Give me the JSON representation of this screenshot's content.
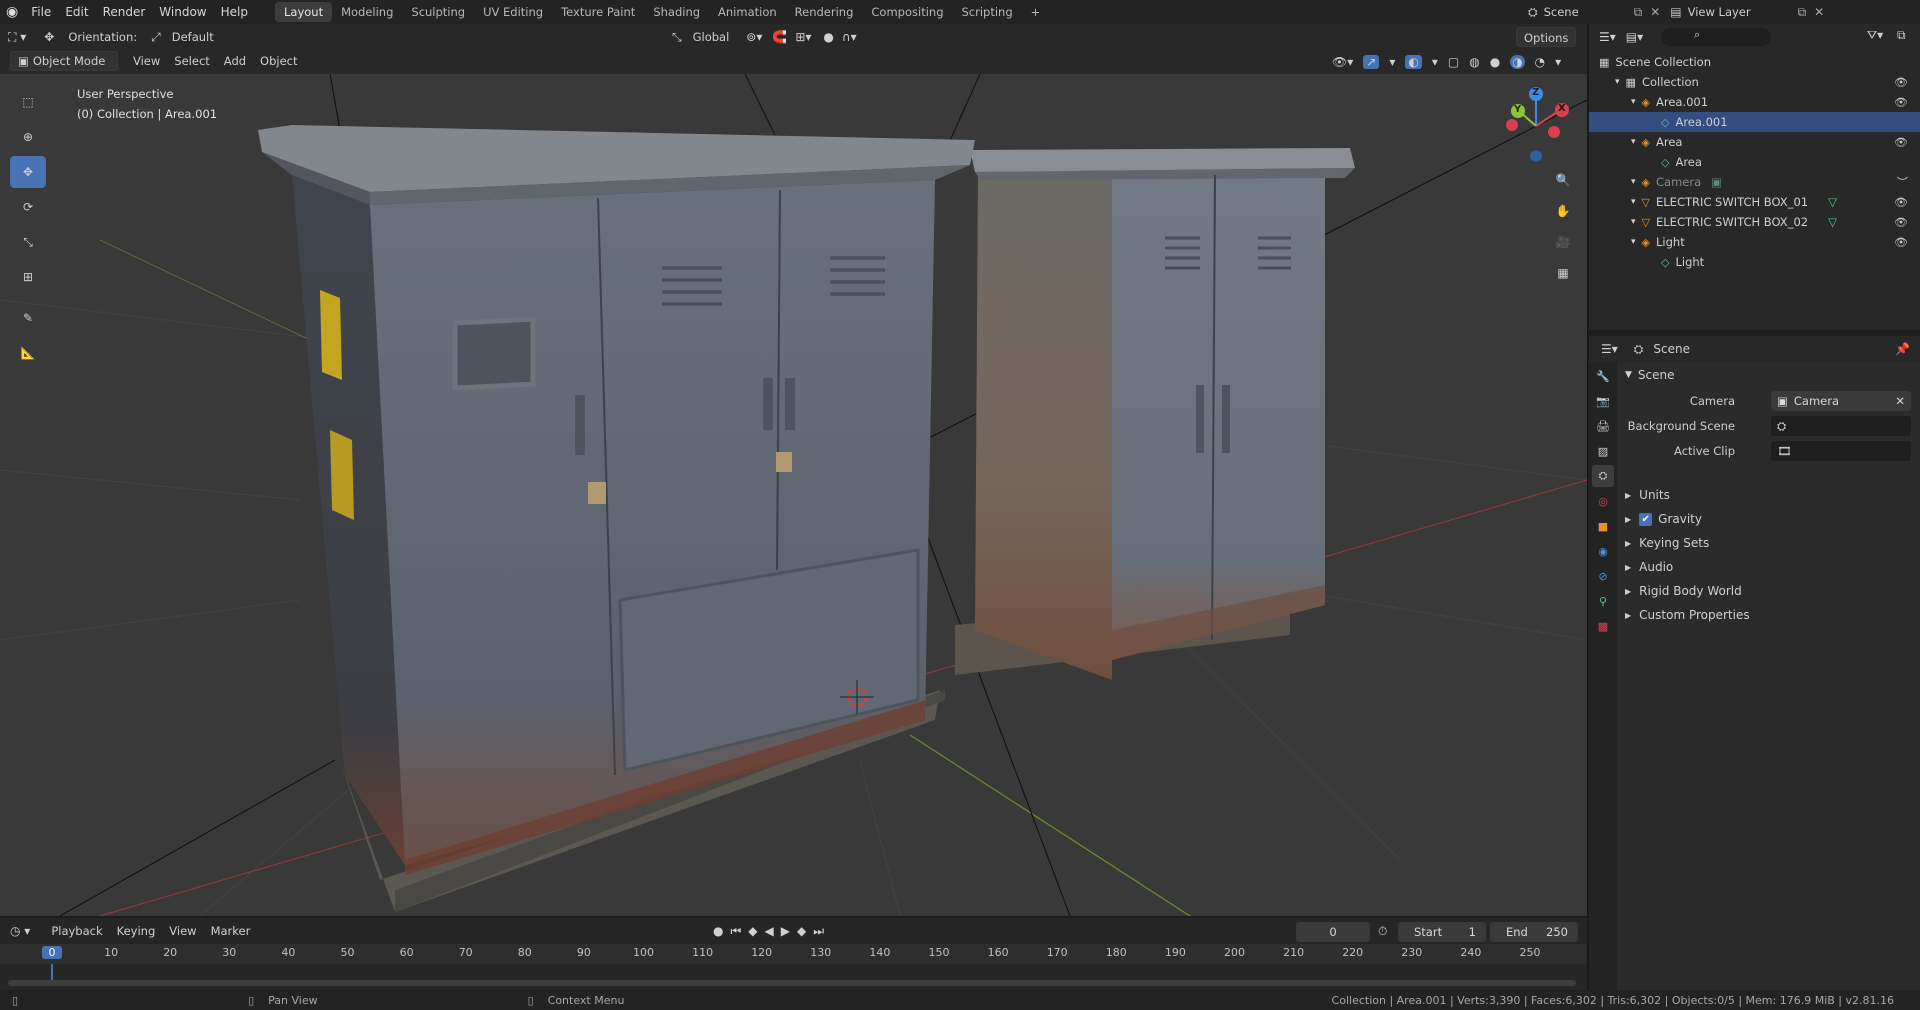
{
  "topbar": {
    "menus": [
      "File",
      "Edit",
      "Render",
      "Window",
      "Help"
    ],
    "workspaces": [
      "Layout",
      "Modeling",
      "Sculpting",
      "UV Editing",
      "Texture Paint",
      "Shading",
      "Animation",
      "Rendering",
      "Compositing",
      "Scripting"
    ],
    "add_tab": "+",
    "scene_label": "Scene",
    "view_layer_label": "View Layer"
  },
  "viewport_header": {
    "orientation_label": "Orientation:",
    "orientation_value": "Default",
    "transform_global": "Global",
    "options_label": "Options",
    "mode": "Object Mode",
    "menus": [
      "View",
      "Select",
      "Add",
      "Object"
    ]
  },
  "viewport": {
    "overlay_line1": "User Perspective",
    "overlay_line2": "(0) Collection | Area.001",
    "gizmo": {
      "x": "X",
      "y": "Y",
      "z": "Z"
    }
  },
  "outliner": {
    "search_placeholder": "",
    "items": [
      {
        "label": "Scene Collection",
        "indent": 0
      },
      {
        "label": "Collection",
        "indent": 1
      },
      {
        "label": "Area.001",
        "indent": 2
      },
      {
        "label": "Area.001",
        "indent": 3,
        "selected": true
      },
      {
        "label": "Area",
        "indent": 2
      },
      {
        "label": "Area",
        "indent": 3
      },
      {
        "label": "Camera",
        "indent": 2,
        "dim": true
      },
      {
        "label": "ELECTRIC SWITCH BOX_01",
        "indent": 2
      },
      {
        "label": "ELECTRIC SWITCH BOX_02",
        "indent": 2
      },
      {
        "label": "Light",
        "indent": 2
      },
      {
        "label": "Light",
        "indent": 3
      }
    ]
  },
  "properties": {
    "header_title": "Scene",
    "panel_title": "Scene",
    "camera_label": "Camera",
    "camera_value": "Camera",
    "background_scene_label": "Background Scene",
    "active_clip_label": "Active Clip",
    "sections": [
      "Units",
      "Gravity",
      "Keying Sets",
      "Audio",
      "Rigid Body World",
      "Custom Properties"
    ],
    "gravity_checked": true
  },
  "timeline": {
    "menus": [
      "Playback",
      "Keying",
      "View",
      "Marker"
    ],
    "current_frame": "0",
    "start_label": "Start",
    "start_value": "1",
    "end_label": "End",
    "end_value": "250",
    "ruler": [
      "0",
      "10",
      "20",
      "30",
      "40",
      "50",
      "60",
      "70",
      "80",
      "90",
      "100",
      "110",
      "120",
      "130",
      "140",
      "150",
      "160",
      "170",
      "180",
      "190",
      "200",
      "210",
      "220",
      "230",
      "240",
      "250"
    ]
  },
  "statusbar": {
    "pan_view": "Pan View",
    "context_menu": "Context Menu",
    "stats": "Collection | Area.001 | Verts:3,390 | Faces:6,302 | Tris:6,302 | Objects:0/5 | Mem: 176.9 MiB | v2.81.16"
  },
  "colors": {
    "accent": "#4772b3",
    "selection": "#334d80",
    "x_axis": "#d9424c",
    "y_axis": "#8cc43c",
    "z_axis": "#3d8be3"
  }
}
